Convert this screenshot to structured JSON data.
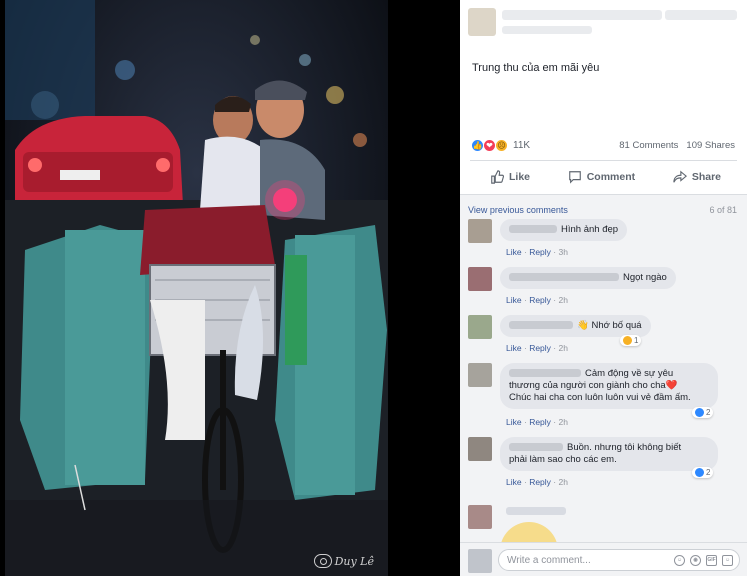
{
  "post": {
    "caption": "Trung thu của em mãi yêu",
    "reaction_count": "11K",
    "comment_count": "81 Comments",
    "share_count": "109 Shares",
    "actions": {
      "like": "Like",
      "comment": "Comment",
      "share": "Share"
    },
    "reaction_icons": [
      "like-icon",
      "love-icon",
      "sad-icon"
    ]
  },
  "comments_header": {
    "view_previous": "View previous comments",
    "count": "6 of 81"
  },
  "comments": [
    {
      "text": "Hình ảnh đẹp",
      "like": "Like",
      "reply": "Reply",
      "time": "3h"
    },
    {
      "text": "Ngọt ngào",
      "like": "Like",
      "reply": "Reply",
      "time": "2h"
    },
    {
      "text": "👋 Nhớ bố quá",
      "like": "Like",
      "reply": "Reply",
      "time": "2h",
      "reactions": "1"
    },
    {
      "line1": "Cảm động về sự yêu",
      "line2": "thương của người con giành cho cha❤️",
      "line3": "Chúc hai cha con luôn luôn vui vẻ đầm ấm.",
      "like": "Like",
      "reply": "Reply",
      "time": "2h",
      "reactions": "2"
    },
    {
      "line1": "Buồn. nhưng tôi không biết",
      "line2": "phải làm sao cho các em.",
      "like": "Like",
      "reply": "Reply",
      "time": "2h",
      "reactions": "2"
    }
  ],
  "compose": {
    "placeholder": "Write a comment...",
    "icons": [
      "emoji-icon",
      "camera-icon",
      "gif-icon",
      "sticker-icon"
    ]
  },
  "watermark": "Duy Lê",
  "colors": {
    "link": "#385898",
    "like_blue": "#2d88ff",
    "love_red": "#f33e58",
    "sad_yellow": "#f7b125"
  }
}
